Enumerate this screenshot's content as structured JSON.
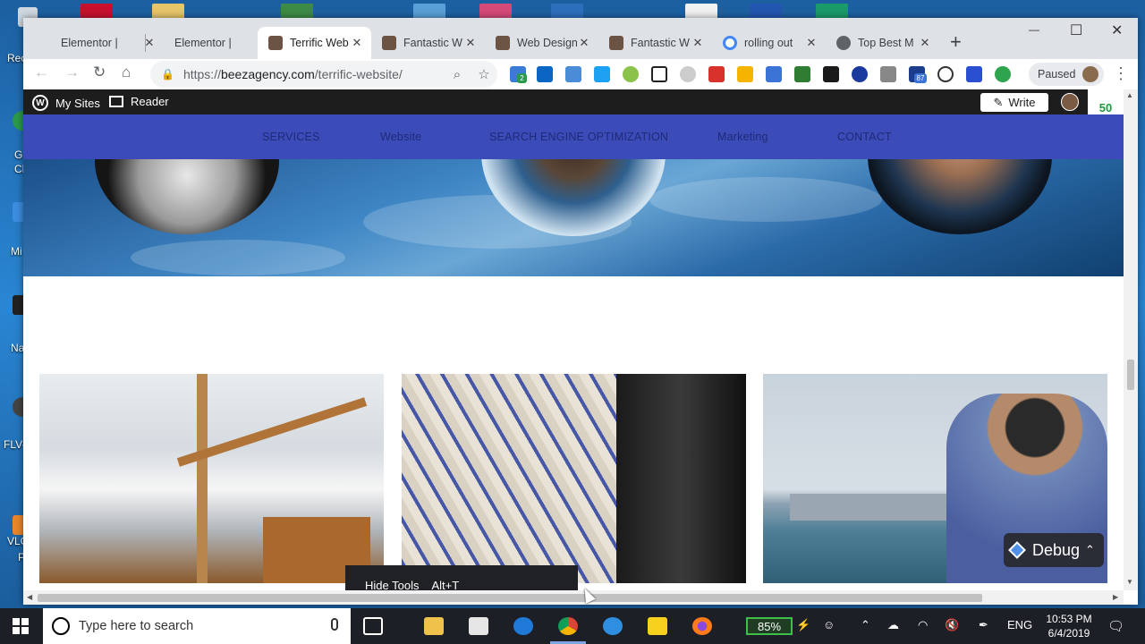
{
  "desktop": {
    "icon_labels": [
      "Recl",
      "G",
      "Cl",
      "Mi",
      "Na",
      "FLV-",
      "VLC",
      "P"
    ]
  },
  "browser": {
    "tabs": [
      {
        "title": "Elementor |",
        "active": false
      },
      {
        "title": "Elementor |",
        "active": false
      },
      {
        "title": "Terrific Web",
        "active": true
      },
      {
        "title": "Fantastic W",
        "active": false
      },
      {
        "title": "Web Design",
        "active": false
      },
      {
        "title": "Fantastic W",
        "active": false
      },
      {
        "title": "rolling out",
        "active": false
      },
      {
        "title": "Top Best M",
        "active": false
      }
    ],
    "tab_close": "✕",
    "new_tab": "+",
    "window_controls": {
      "minimize": "—",
      "maximize": "☐",
      "close": "✕"
    },
    "nav": {
      "back": "←",
      "forward": "→",
      "reload": "↻",
      "home": "⌂"
    },
    "url_prefix": "https://",
    "url_domain": "beezagency.com",
    "url_path": "/terrific-website/",
    "profile_status": "Paused",
    "extension_badges": [
      "2",
      "87"
    ]
  },
  "wp_admin": {
    "my_sites": "My Sites",
    "reader": "Reader",
    "write": "Write",
    "corner_badge": "50"
  },
  "site_nav": [
    "SERVICES",
    "Website",
    "SEARCH ENGINE OPTIMIZATION",
    "Marketing",
    "CONTACT"
  ],
  "overlays": {
    "hide_tools": "Hide Tools",
    "hide_tools_shortcut": "Alt+T",
    "debug": "Debug"
  },
  "taskbar": {
    "search_placeholder": "Type here to search",
    "battery": "85%",
    "language": "ENG",
    "time": "10:53 PM",
    "date": "6/4/2019"
  },
  "colors": {
    "site_nav_bg": "#3b4bb8",
    "wp_bar_bg": "#1d1d1d",
    "tab_strip": "#dee1e6"
  }
}
